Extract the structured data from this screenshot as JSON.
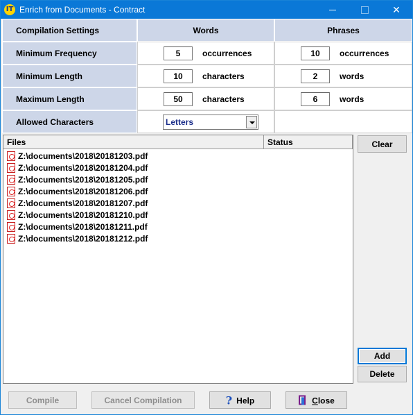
{
  "window": {
    "title": "Enrich from Documents - Contract",
    "app_icon_text": "IT"
  },
  "settings": {
    "header": {
      "label": "Compilation Settings",
      "words": "Words",
      "phrases": "Phrases"
    },
    "rows": [
      {
        "label": "Minimum Frequency",
        "words_value": "5",
        "words_unit": "occurrences",
        "phrases_value": "10",
        "phrases_unit": "occurrences"
      },
      {
        "label": "Minimum Length",
        "words_value": "10",
        "words_unit": "characters",
        "phrases_value": "2",
        "phrases_unit": "words"
      },
      {
        "label": "Maximum Length",
        "words_value": "50",
        "words_unit": "characters",
        "phrases_value": "6",
        "phrases_unit": "words"
      }
    ],
    "allowed": {
      "label": "Allowed Characters",
      "selected": "Letters"
    }
  },
  "files": {
    "columns": {
      "files": "Files",
      "status": "Status"
    },
    "items": [
      "Z:\\documents\\2018\\20181203.pdf",
      "Z:\\documents\\2018\\20181204.pdf",
      "Z:\\documents\\2018\\20181205.pdf",
      "Z:\\documents\\2018\\20181206.pdf",
      "Z:\\documents\\2018\\20181207.pdf",
      "Z:\\documents\\2018\\20181210.pdf",
      "Z:\\documents\\2018\\20181211.pdf",
      "Z:\\documents\\2018\\20181212.pdf"
    ]
  },
  "side_buttons": {
    "clear": "Clear",
    "add": "Add",
    "delete": "Delete"
  },
  "bottom_buttons": {
    "compile": "Compile",
    "cancel_compilation": "Cancel Compilation",
    "help": "Help",
    "close_prefix": "C",
    "close_rest": "lose"
  }
}
